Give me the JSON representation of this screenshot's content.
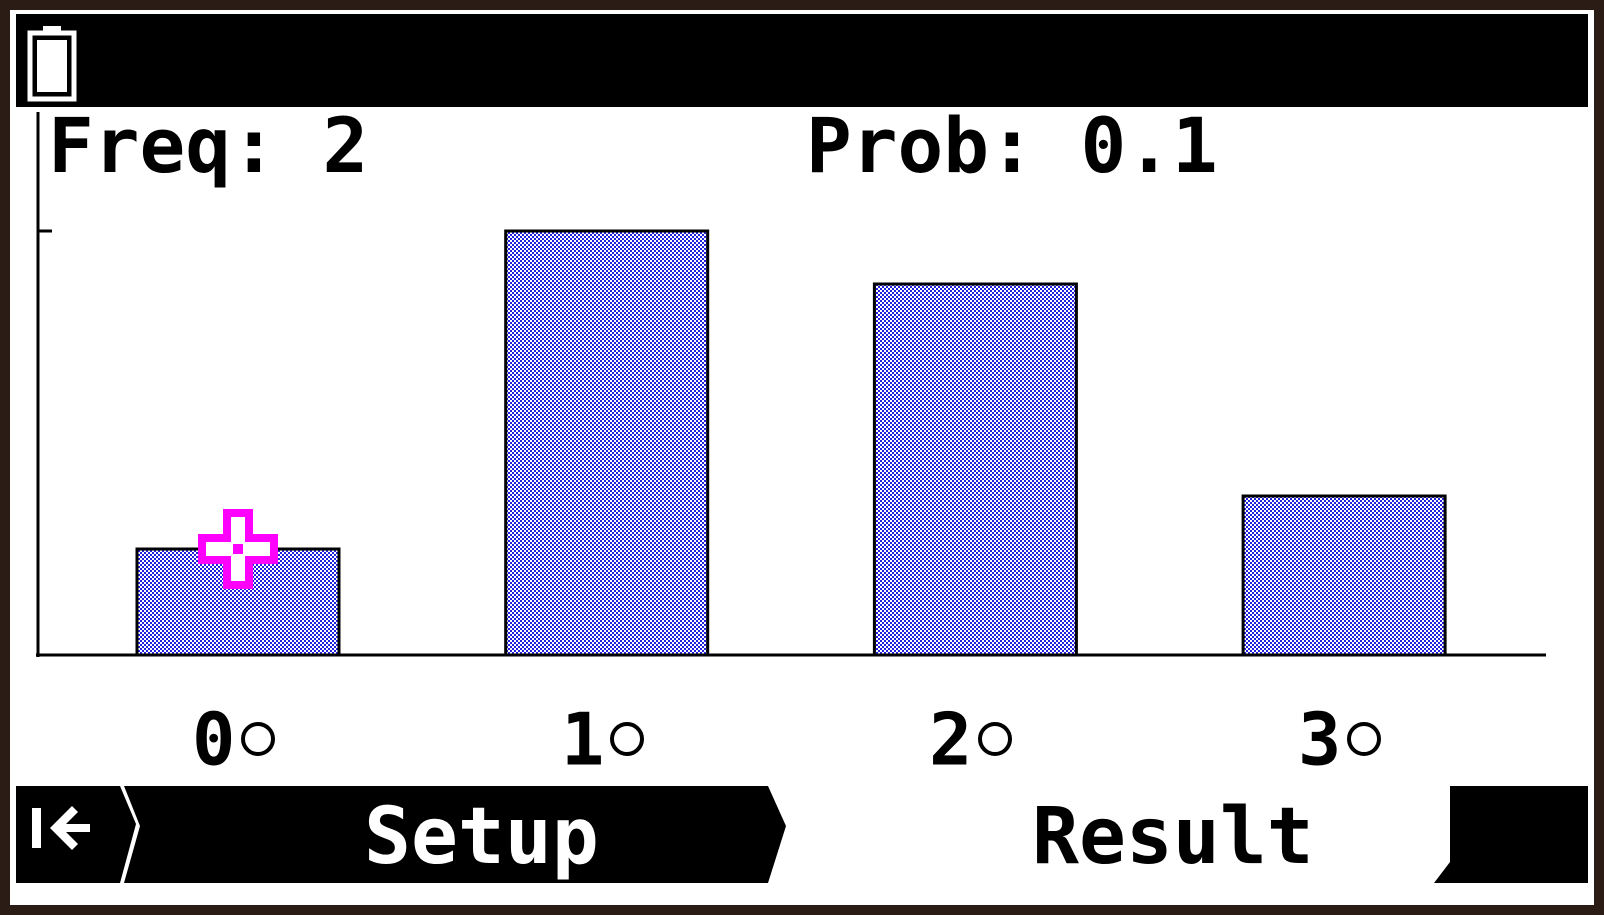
{
  "status": {
    "battery_icon": "battery-icon"
  },
  "readout": {
    "freq_label": "Freq:",
    "freq_value": "2",
    "prob_label": "Prob:",
    "prob_value": "0.1"
  },
  "chart_data": {
    "type": "bar",
    "categories": [
      "0",
      "1",
      "2",
      "3"
    ],
    "values": [
      2,
      8,
      7,
      3
    ],
    "bar_color": "#2222dd",
    "cursor_category": "0",
    "cursor_color": "#ff00ff"
  },
  "softkeys": {
    "back_icon": "back-to-start-icon",
    "setup_label": "Setup",
    "result_label": "Result"
  },
  "colors": {
    "screen_bg": "#ffffff",
    "bar_fill": "#2222dd",
    "cursor": "#ff00ff"
  }
}
